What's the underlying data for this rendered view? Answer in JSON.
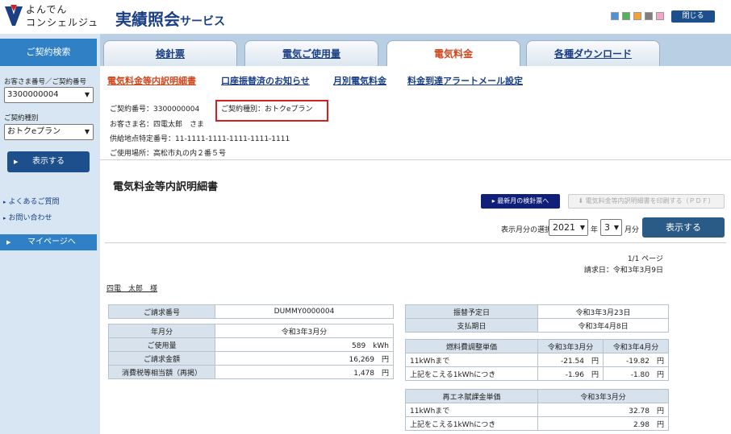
{
  "header": {
    "logo_line1": "よんでん",
    "logo_line2": "コンシェルジュ",
    "service_title_main": "実績照会",
    "service_title_sub": "サービス",
    "theme_colors": [
      "#4f93d6",
      "#58b05e",
      "#f0a23c",
      "#7f7f7f",
      "#f0a6c4"
    ],
    "close_label": "閉じる"
  },
  "sidebar": {
    "heading": "ご契約検索",
    "customer_no_label": "お客さま番号／ご契約番号",
    "customer_no_value": "3300000004",
    "contract_type_label": "ご契約種別",
    "contract_type_value": "おトクeプラン",
    "show_button": "表示する",
    "links": [
      "よくあるご質問",
      "お問い合わせ"
    ],
    "mypage_label": "マイページへ"
  },
  "tabs": [
    {
      "label": "検針票",
      "active": false
    },
    {
      "label": "電気ご使用量",
      "active": false
    },
    {
      "label": "電気料金",
      "active": true
    },
    {
      "label": "各種ダウンロード",
      "active": false
    }
  ],
  "subnav": [
    {
      "label": "電気料金等内訳明細書",
      "active": true
    },
    {
      "label": "口座振替済のお知らせ",
      "active": false
    },
    {
      "label": "月別電気料金",
      "active": false
    },
    {
      "label": "料金到達アラートメール設定",
      "active": false
    }
  ],
  "info": {
    "contract_no": "ご契約番号：3300000004",
    "contract_kind": "ご契約種別：おトクeプラン",
    "customer_name": "お客さま名：四電太郎　さま",
    "supply_point": "供給地点特定番号：11-1111-1111-1111-1111-1111",
    "location": "ご使用場所：高松市丸の内２番５号"
  },
  "main": {
    "title": "電気料金等内訳明細書",
    "latest_button": "最新月の検針票へ",
    "print_button": "電気料金等内訳明細書を印刷する（ＰＤＦ）",
    "select_label": "表示月分の選択",
    "year_value": "2021",
    "year_unit": "年",
    "month_value": "3",
    "month_unit": "月分",
    "show_button": "表示する",
    "page_info": "1/1 ページ",
    "bill_date": "請求日：令和3年3月9日",
    "customer": "四電　太郎　様"
  },
  "left_table": {
    "rows": [
      [
        "ご請求番号",
        "DUMMY0000004"
      ],
      [
        "年月分",
        "令和3年3月分"
      ],
      [
        "ご使用量",
        "589　kWh"
      ],
      [
        "ご請求金額",
        "16,269　円"
      ],
      [
        "消費税等相当額（再掲）",
        "1,478　円"
      ]
    ]
  },
  "right_table": {
    "schedule": [
      [
        "振替予定日",
        "令和3年3月23日"
      ],
      [
        "支払期日",
        "令和3年4月8日"
      ]
    ],
    "fuel_header": [
      "燃料費調整単価",
      "令和3年3月分",
      "令和3年4月分"
    ],
    "fuel_rows": [
      [
        "11kWhまで",
        "-21.54　円",
        "-19.82　円"
      ],
      [
        "上記をこえる1kWhにつき",
        "-1.96　円",
        "-1.80　円"
      ]
    ],
    "renew_header": [
      "再エネ賦課金単価",
      "令和3年3月分"
    ],
    "renew_rows": [
      [
        "11kWhまで",
        "32.78　円"
      ],
      [
        "上記をこえる1kWhにつき",
        "2.98　円"
      ]
    ]
  }
}
